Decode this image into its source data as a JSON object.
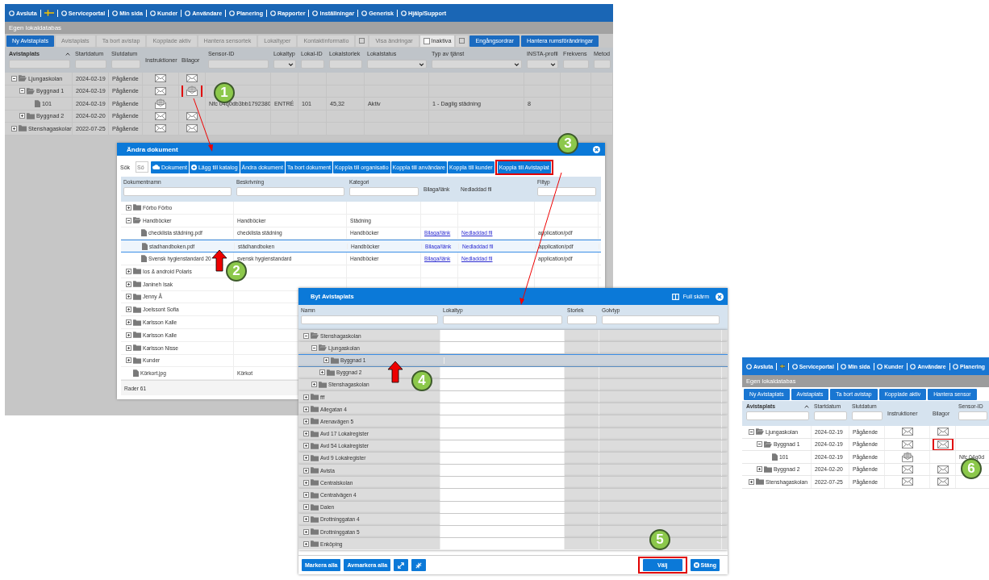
{
  "main_screen": {
    "menu": [
      {
        "kind": "link",
        "label": "Avsluta"
      },
      {
        "kind": "flag"
      },
      {
        "kind": "link",
        "label": "Serviceportal"
      },
      {
        "kind": "link",
        "label": "Min sida"
      },
      {
        "kind": "link",
        "label": "Kunder"
      },
      {
        "kind": "link",
        "label": "Användare"
      },
      {
        "kind": "link",
        "label": "Planering"
      },
      {
        "kind": "link",
        "label": "Rapporter"
      },
      {
        "kind": "link",
        "label": "Inställningar"
      },
      {
        "kind": "link",
        "label": "Generisk"
      },
      {
        "kind": "link",
        "label": "Hjälp/Support"
      }
    ],
    "title": "Egen lokaldatabas",
    "toolbar": [
      {
        "kind": "button",
        "label": "Ny Avistaplats",
        "disabled": false
      },
      {
        "kind": "button",
        "label": "Avistaplats",
        "disabled": true
      },
      {
        "kind": "button",
        "label": "Ta bort avistap",
        "disabled": true
      },
      {
        "kind": "button",
        "label": "Kopplade aktiv",
        "disabled": true
      },
      {
        "kind": "button",
        "label": "Hantera sensortek",
        "disabled": true
      },
      {
        "kind": "button",
        "label": "Lokaltyper",
        "disabled": true
      },
      {
        "kind": "button",
        "label": "Kontaktinformatio",
        "disabled": true
      },
      {
        "kind": "icon-button",
        "disabled": true
      },
      {
        "kind": "button",
        "label": "Visa ändringar",
        "disabled": true
      },
      {
        "kind": "checkbox",
        "label": "Inaktiva",
        "checked": false
      },
      {
        "kind": "icon-button",
        "disabled": true
      },
      {
        "kind": "button",
        "label": "Engångsordrar",
        "disabled": false
      },
      {
        "kind": "button",
        "label": "Hantera rumsförändringar",
        "disabled": false
      }
    ],
    "columns": [
      {
        "label": "Avistaplats",
        "kind": "text-filter",
        "sorted": true
      },
      {
        "label": "Startdatum",
        "kind": "text-filter",
        "sorted": false
      },
      {
        "label": "Slutdatum",
        "kind": "text-filter",
        "sorted": false
      },
      {
        "label": "Instruktioner",
        "kind": "no-filter",
        "sorted": false
      },
      {
        "label": "Bilagor",
        "kind": "no-filter",
        "sorted": false
      },
      {
        "label": "Sensor-ID",
        "kind": "text-filter",
        "sorted": false
      },
      {
        "label": "Lokaltyp",
        "kind": "dropdown-filter",
        "sorted": false
      },
      {
        "label": "Lokal-ID",
        "kind": "text-filter",
        "sorted": false
      },
      {
        "label": "Lokalstorlek",
        "kind": "text-filter",
        "sorted": false
      },
      {
        "label": "Lokalstatus",
        "kind": "dropdown-filter",
        "sorted": false
      },
      {
        "label": "Typ av tjänst",
        "kind": "dropdown-filter",
        "sorted": false
      },
      {
        "label": "INSTA-profil",
        "kind": "dropdown-filter",
        "sorted": false
      },
      {
        "label": "Frekvens",
        "kind": "text-filter",
        "sorted": false
      },
      {
        "label": "Metod",
        "kind": "text-filter",
        "sorted": false
      }
    ],
    "rows": [
      {
        "name": "Ljungaskolan",
        "kind": "folder",
        "expanded": true,
        "start_date": "2024-02-19",
        "end_date": "Pågående",
        "instructions": {
          "kind": "envelope",
          "highlighted": false
        },
        "attachments": {
          "kind": "envelope",
          "highlighted": false
        },
        "children": [
          {
            "name": "Byggnad 1",
            "kind": "folder",
            "expanded": true,
            "start_date": "2024-02-19",
            "end_date": "Pågående",
            "instructions": {
              "kind": "envelope",
              "highlighted": false
            },
            "attachments": {
              "kind": "letter",
              "highlighted": true
            },
            "children": [
              {
                "name": "101",
                "kind": "file",
                "start_date": "2024-02-19",
                "end_date": "Pågående",
                "instructions": {
                  "kind": "letter",
                  "highlighted": false
                },
                "sensor_id": "Nfc 04q0db3bb1792380",
                "room_type": "ENTRÉ",
                "room_id": "101",
                "room_size": "45,32",
                "room_status": "Aktiv",
                "service_type": "1 - Daglig städning",
                "insta_profile": "8"
              }
            ]
          },
          {
            "name": "Byggnad 2",
            "kind": "folder",
            "expanded": false,
            "start_date": "2024-02-20",
            "end_date": "Pågående",
            "instructions": {
              "kind": "envelope",
              "highlighted": false
            },
            "attachments": {
              "kind": "envelope",
              "highlighted": false
            }
          }
        ]
      },
      {
        "name": "Stenshagaskolan",
        "kind": "folder",
        "expanded": false,
        "start_date": "2022-07-25",
        "end_date": "Pågående",
        "instructions": {
          "kind": "envelope",
          "highlighted": false
        },
        "attachments": {
          "kind": "envelope",
          "highlighted": false
        }
      }
    ]
  },
  "document_dialog": {
    "title": "Ändra dokument",
    "search_label": "Sök",
    "search_placeholder": "Sö",
    "buttons": [
      {
        "label": "Dokument",
        "highlighted": false
      },
      {
        "label": "Lägg till katalog",
        "highlighted": false
      },
      {
        "label": "Ändra dokument",
        "highlighted": false
      },
      {
        "label": "Ta bort dokument",
        "highlighted": false
      },
      {
        "label": "Koppla till organisatio",
        "highlighted": false
      },
      {
        "label": "Koppla till användare",
        "highlighted": false
      },
      {
        "label": "Koppla till kunder",
        "highlighted": false
      },
      {
        "label": "Koppla till Avistaplat",
        "highlighted": true
      }
    ],
    "columns": [
      {
        "label": "Dokumentnamn",
        "kind": "text-filter"
      },
      {
        "label": "Beskrivning",
        "kind": "text-filter"
      },
      {
        "label": "Kategori",
        "kind": "text-filter"
      },
      {
        "label": "Bilaga/länk",
        "kind": "no-filter"
      },
      {
        "label": "Nedladdad fil",
        "kind": "no-filter"
      },
      {
        "label": "Filtyp",
        "kind": "text-filter"
      }
    ],
    "rows": [
      {
        "name": "Förbo Förbo",
        "kind": "folder",
        "expanded": false,
        "selected": false
      },
      {
        "name": "Handböcker",
        "kind": "folder",
        "expanded": true,
        "selected": false,
        "description": "Handböcker",
        "category": "Städning",
        "children": [
          {
            "name": "checklista städning.pdf",
            "kind": "file",
            "selected": false,
            "description": "checklista städning",
            "category": "Handböcker",
            "attachment_link": "Bilaga/länk",
            "downloaded_file": "Nedladdad fil",
            "file_type": "application/pdf"
          },
          {
            "name": "stadhandboken.pdf",
            "kind": "file",
            "selected": true,
            "description": "städhandboken",
            "category": "Handböcker",
            "attachment_link": "Bilaga/länk",
            "downloaded_file": "Nedladdad fil",
            "file_type": "application/pdf"
          },
          {
            "name": "Svensk hygienstandard 20",
            "kind": "file",
            "selected": false,
            "description": "svensk hygienstandard",
            "category": "Handböcker",
            "attachment_link": "Bilaga/länk",
            "downloaded_file": "Nedladdad fil",
            "file_type": "application/pdf"
          }
        ]
      },
      {
        "name": "Ios & android Polaris",
        "kind": "folder",
        "expanded": false,
        "selected": false
      },
      {
        "name": "Janineh Isak",
        "kind": "folder",
        "expanded": false,
        "selected": false
      },
      {
        "name": "Jenny Å",
        "kind": "folder",
        "expanded": false,
        "selected": false
      },
      {
        "name": "Joelssont Sofia",
        "kind": "folder",
        "expanded": false,
        "selected": false
      },
      {
        "name": "Karlsson Kalle",
        "kind": "folder",
        "expanded": false,
        "selected": false
      },
      {
        "name": "Karlsson Kalle",
        "kind": "folder",
        "expanded": false,
        "selected": false
      },
      {
        "name": "Karlsson Nisse",
        "kind": "folder",
        "expanded": false,
        "selected": false
      },
      {
        "name": "Kunder",
        "kind": "folder",
        "expanded": false,
        "selected": false
      },
      {
        "name": "Körkort.jpg",
        "kind": "file",
        "selected": false,
        "description": "Körkot"
      }
    ],
    "footer": "Rader 61"
  },
  "location_dialog": {
    "title": "Byt Avistaplats",
    "fullscreen_label": "Full skärm",
    "columns": [
      {
        "label": "Namn",
        "kind": "text-filter"
      },
      {
        "label": "Lokaltyp",
        "kind": "text-filter"
      },
      {
        "label": "Storlek",
        "kind": "text-filter"
      },
      {
        "label": "Golvtyp",
        "kind": "text-filter"
      }
    ],
    "rows": [
      {
        "name": "Stenshagaskolan",
        "kind": "folder",
        "expanded": true,
        "selected": false,
        "children": [
          {
            "name": "Ljungaskolan",
            "kind": "folder",
            "expanded": true,
            "selected": false,
            "children": [
              {
                "name": "Byggnad 1",
                "kind": "folder",
                "expanded": false,
                "selected": true
              },
              {
                "name": "Byggnad 2",
                "kind": "folder",
                "expanded": false,
                "selected": false
              }
            ]
          },
          {
            "name": "Stenshagaskolan",
            "kind": "folder",
            "expanded": false,
            "selected": false
          }
        ]
      },
      {
        "name": "fff",
        "kind": "folder",
        "expanded": false,
        "selected": false
      },
      {
        "name": "Allegatan 4",
        "kind": "folder",
        "expanded": false,
        "selected": false
      },
      {
        "name": "Arenavägen 5",
        "kind": "folder",
        "expanded": false,
        "selected": false
      },
      {
        "name": "Avd 17 Lokalregister",
        "kind": "folder",
        "expanded": false,
        "selected": false
      },
      {
        "name": "Avd 54 Lokalregister",
        "kind": "folder",
        "expanded": false,
        "selected": false
      },
      {
        "name": "Avd 9 Lokalregister",
        "kind": "folder",
        "expanded": false,
        "selected": false
      },
      {
        "name": "Avista",
        "kind": "folder",
        "expanded": false,
        "selected": false
      },
      {
        "name": "Centralskolan",
        "kind": "folder",
        "expanded": false,
        "selected": false
      },
      {
        "name": "Centralvägen 4",
        "kind": "folder",
        "expanded": false,
        "selected": false
      },
      {
        "name": "Dalen",
        "kind": "folder",
        "expanded": false,
        "selected": false
      },
      {
        "name": "Drottninggatan 4",
        "kind": "folder",
        "expanded": false,
        "selected": false
      },
      {
        "name": "Drottninggatan 5",
        "kind": "folder",
        "expanded": false,
        "selected": false
      },
      {
        "name": "Enköping",
        "kind": "folder",
        "expanded": false,
        "selected": false
      }
    ],
    "footer_buttons": [
      {
        "kind": "text",
        "label": "Markera alla",
        "highlighted": false
      },
      {
        "kind": "text",
        "label": "Avmarkera alla",
        "highlighted": false
      },
      {
        "kind": "expand",
        "highlighted": false
      },
      {
        "kind": "collapse",
        "highlighted": false
      },
      {
        "kind": "primary",
        "label": "Välj",
        "highlighted": true
      },
      {
        "kind": "close",
        "label": "Stäng",
        "highlighted": false
      }
    ]
  },
  "result_screen": {
    "menu": [
      {
        "kind": "link",
        "label": "Avsluta"
      },
      {
        "kind": "flag"
      },
      {
        "kind": "link",
        "label": "Serviceportal"
      },
      {
        "kind": "link",
        "label": "Min sida"
      },
      {
        "kind": "link",
        "label": "Kunder"
      },
      {
        "kind": "link",
        "label": "Användare"
      },
      {
        "kind": "link",
        "label": "Planering"
      }
    ],
    "title": "Egen lokaldatabas",
    "toolbar": [
      {
        "kind": "button",
        "label": "Ny Avistaplats",
        "disabled": false
      },
      {
        "kind": "button",
        "label": "Avistaplats",
        "disabled": false
      },
      {
        "kind": "button",
        "label": "Ta bort avistap",
        "disabled": false
      },
      {
        "kind": "button",
        "label": "Kopplade aktiv",
        "disabled": false
      },
      {
        "kind": "button",
        "label": "Hantera sensor",
        "disabled": false
      }
    ],
    "columns": [
      {
        "label": "Avistaplats",
        "kind": "text-filter",
        "sorted": true
      },
      {
        "label": "Startdatum",
        "kind": "text-filter",
        "sorted": false
      },
      {
        "label": "Slutdatum",
        "kind": "text-filter",
        "sorted": false
      },
      {
        "label": "Instruktioner",
        "kind": "no-filter",
        "sorted": false
      },
      {
        "label": "Bilagor",
        "kind": "no-filter",
        "sorted": false
      },
      {
        "label": "Sensor-ID",
        "kind": "text-filter",
        "sorted": false
      }
    ],
    "rows": [
      {
        "name": "Ljungaskolan",
        "kind": "folder",
        "expanded": true,
        "start_date": "2024-02-19",
        "end_date": "Pågående",
        "instructions": {
          "kind": "envelope",
          "highlighted": false
        },
        "attachments": {
          "kind": "envelope",
          "highlighted": false
        },
        "children": [
          {
            "name": "Byggnad 1",
            "kind": "folder",
            "expanded": true,
            "start_date": "2024-02-19",
            "end_date": "Pågående",
            "instructions": {
              "kind": "envelope",
              "highlighted": false
            },
            "attachments": {
              "kind": "envelope",
              "highlighted": true
            },
            "children": [
              {
                "name": "101",
                "kind": "file",
                "start_date": "2024-02-19",
                "end_date": "Pågående",
                "instructions": {
                  "kind": "letter",
                  "highlighted": false
                },
                "sensor_id": "Nfc 04q0d"
              }
            ]
          },
          {
            "name": "Byggnad 2",
            "kind": "folder",
            "expanded": false,
            "start_date": "2024-02-20",
            "end_date": "Pågående",
            "instructions": {
              "kind": "envelope",
              "highlighted": false
            },
            "attachments": {
              "kind": "envelope",
              "highlighted": false
            }
          }
        ]
      },
      {
        "name": "Stenshagaskolan",
        "kind": "folder",
        "expanded": false,
        "start_date": "2022-07-25",
        "end_date": "Pågående",
        "instructions": {
          "kind": "envelope",
          "highlighted": false
        },
        "attachments": {
          "kind": "envelope",
          "highlighted": false
        }
      }
    ]
  },
  "callouts": [
    {
      "number": "1"
    },
    {
      "number": "2"
    },
    {
      "number": "3"
    },
    {
      "number": "4"
    },
    {
      "number": "5"
    },
    {
      "number": "6"
    }
  ]
}
